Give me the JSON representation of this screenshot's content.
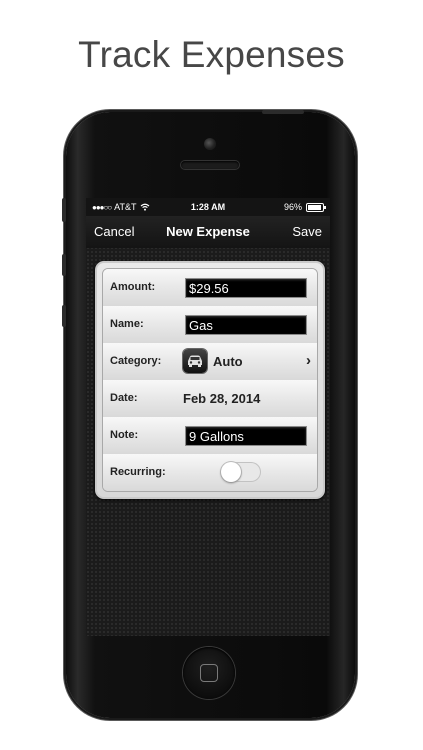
{
  "headline": "Track Expenses",
  "status_bar": {
    "carrier": "AT&T",
    "signal_dots": "●●●○○",
    "time": "1:28 AM",
    "battery_percent": "96%",
    "battery_level": 0.96
  },
  "nav": {
    "left_button": "Cancel",
    "title": "New Expense",
    "right_button": "Save"
  },
  "form": {
    "amount_label": "Amount:",
    "amount_value": "$29.56",
    "name_label": "Name:",
    "name_value": "Gas",
    "category_label": "Category:",
    "category_value": "Auto",
    "category_icon": "car-icon",
    "date_label": "Date:",
    "date_value": "Feb 28, 2014",
    "note_label": "Note:",
    "note_value": "9 Gallons",
    "recurring_label": "Recurring:",
    "recurring_on": false
  },
  "colors": {
    "headline": "#474747",
    "field_bg": "#000000",
    "screen_bg": "#1b1b1b"
  }
}
